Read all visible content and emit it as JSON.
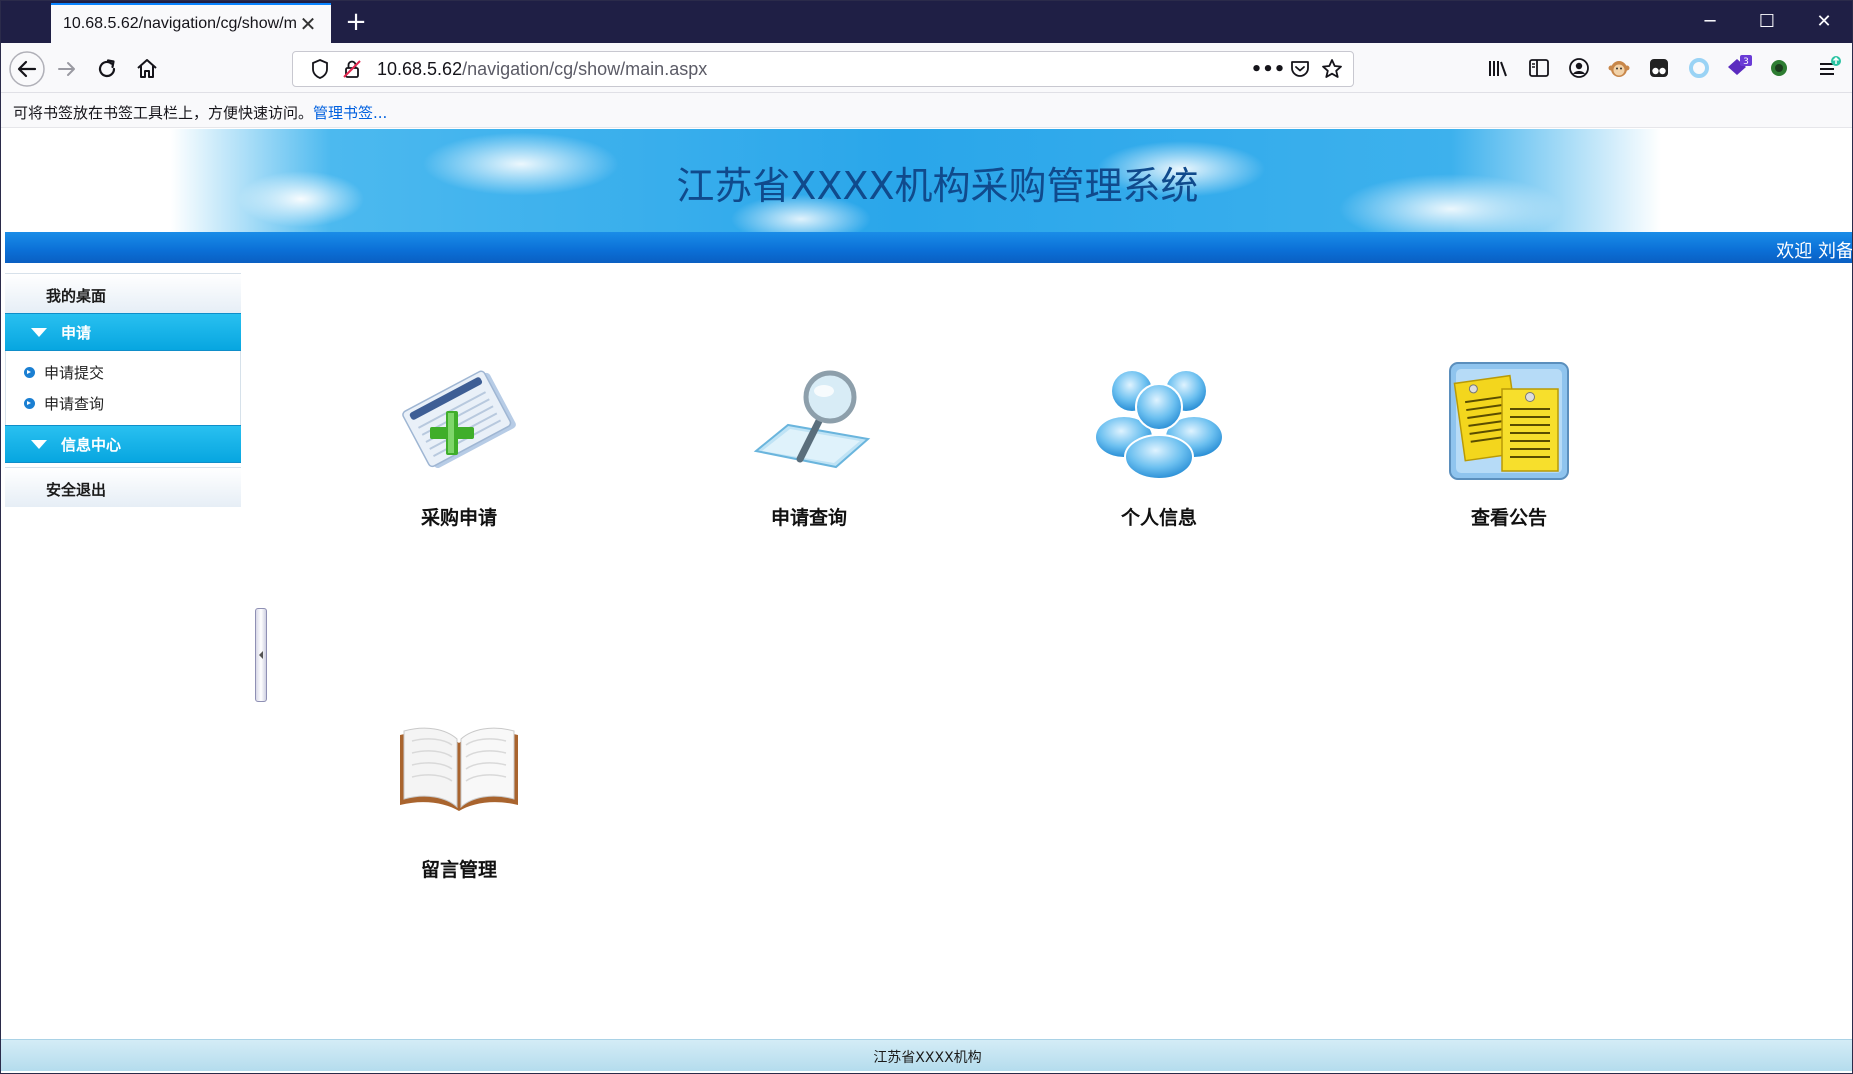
{
  "browser": {
    "tab_title": "10.68.5.62/navigation/cg/show/m",
    "url_host": "10.68.5.62",
    "url_path": "/navigation/cg/show/main.aspx",
    "bookmark_hint": "可将书签放在书签工具栏上，方便快速访问。",
    "bookmark_link": "管理书签...",
    "extension_badge": "3",
    "window_controls": [
      "minimize-icon",
      "maximize-icon",
      "close-icon"
    ]
  },
  "header": {
    "system_title": "江苏省XXXX机构采购管理系统",
    "welcome": "欢迎 刘备"
  },
  "sidebar": {
    "desktop": "我的桌面",
    "group_apply": "申请",
    "apply_items": [
      {
        "label": "申请提交"
      },
      {
        "label": "申请查询"
      }
    ],
    "group_info": "信息中心",
    "logout": "安全退出"
  },
  "tiles": [
    {
      "label": "采购申请",
      "icon": "document-add-icon"
    },
    {
      "label": "申请查询",
      "icon": "magnifier-icon"
    },
    {
      "label": "个人信息",
      "icon": "users-icon"
    },
    {
      "label": "查看公告",
      "icon": "notes-icon"
    },
    {
      "label": "留言管理",
      "icon": "book-icon"
    }
  ],
  "footer": {
    "text": "江苏省XXXX机构"
  },
  "colors": {
    "welcome_bar": "#0b6fd6",
    "sidebar_group": "#07a6e0",
    "title_text": "#104a8c",
    "footer_bg": "#c4e4f2"
  }
}
